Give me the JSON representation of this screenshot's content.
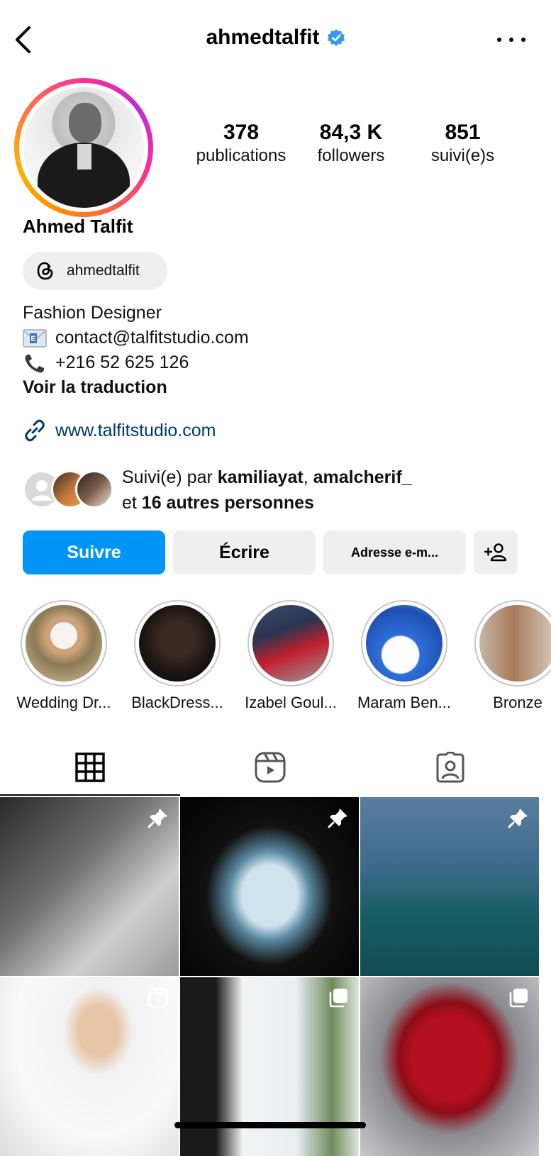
{
  "header": {
    "username": "ahmedtalfit",
    "verified_color": "#3897f0",
    "back_icon": "chevron-left-icon",
    "more_icon": "more-horizontal-icon"
  },
  "profile": {
    "display_name": "Ahmed Talfit",
    "threads_handle": "ahmedtalfit",
    "stats": [
      {
        "value": "378",
        "label": "publications"
      },
      {
        "value": "84,3 K",
        "label": "followers"
      },
      {
        "value": "851",
        "label": "suivi(e)s"
      }
    ],
    "bio": {
      "line1": "Fashion Designer",
      "email": "contact@talfitstudio.com",
      "phone": "+216 52 625 126",
      "translate": "Voir la traduction"
    },
    "website": "www.talfitstudio.com",
    "followed_by": {
      "prefix": "Suivi(e) par ",
      "user1": "kamiliayat",
      "sep": ", ",
      "user2": "amalcherif_",
      "et": "et ",
      "others": "16 autres personnes"
    }
  },
  "actions": {
    "follow": "Suivre",
    "message": "Écrire",
    "email": "Adresse e-m...",
    "accent_color": "#0095f6"
  },
  "highlights": [
    {
      "label": "Wedding Dr..."
    },
    {
      "label": "BlackDress..."
    },
    {
      "label": "Izabel Goul..."
    },
    {
      "label": "Maram Ben..."
    },
    {
      "label": "Bronze"
    }
  ],
  "tabs": [
    {
      "icon": "grid-icon",
      "active": true
    },
    {
      "icon": "reels-icon",
      "active": false
    },
    {
      "icon": "tagged-icon",
      "active": false
    }
  ]
}
